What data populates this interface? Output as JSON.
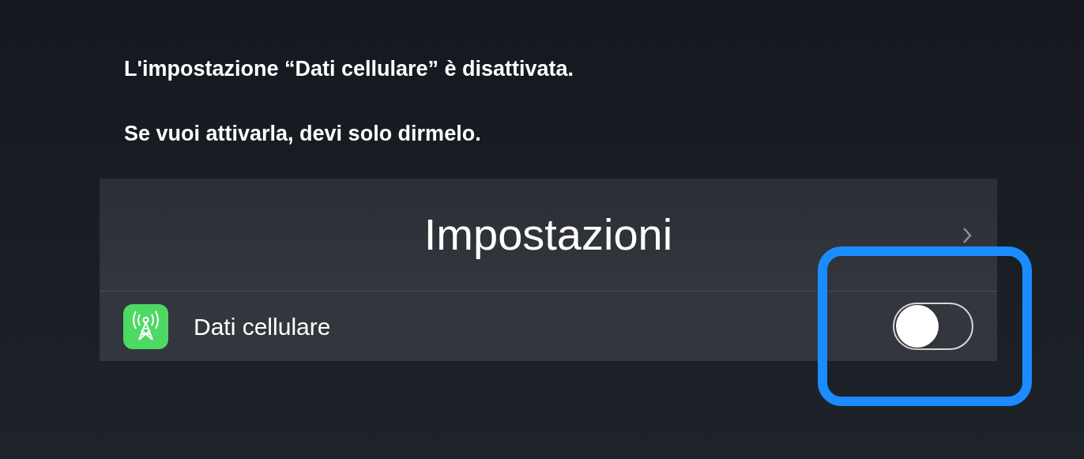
{
  "messages": [
    "L'impostazione “Dati cellulare” è disattivata.",
    "Se vuoi attivarla, devi solo dirmelo."
  ],
  "settings": {
    "title": "Impostazioni",
    "rows": [
      {
        "label": "Dati cellulare",
        "on": false
      }
    ]
  }
}
